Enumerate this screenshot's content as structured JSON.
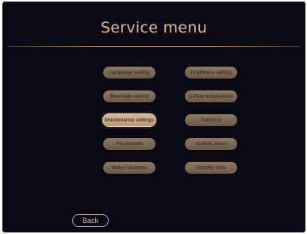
{
  "title": "Service menu",
  "menu": {
    "left": [
      {
        "label": "Language setting"
      },
      {
        "label": "Beverage setting"
      },
      {
        "label": "Maintenance settings"
      },
      {
        "label": "Pre-brewed"
      },
      {
        "label": "Water hardness"
      }
    ],
    "right": [
      {
        "label": "Brightness setting"
      },
      {
        "label": "Coffee temperature"
      },
      {
        "label": "Statistics"
      },
      {
        "label": "Audible alarm"
      },
      {
        "label": "Standby time"
      }
    ],
    "selected_label": "Maintenance settings"
  },
  "back_label": "Back",
  "colors": {
    "background": "#0a0a16",
    "title": "#e8b98a",
    "button": "#7a6856",
    "button_selected": "#c9a882"
  }
}
